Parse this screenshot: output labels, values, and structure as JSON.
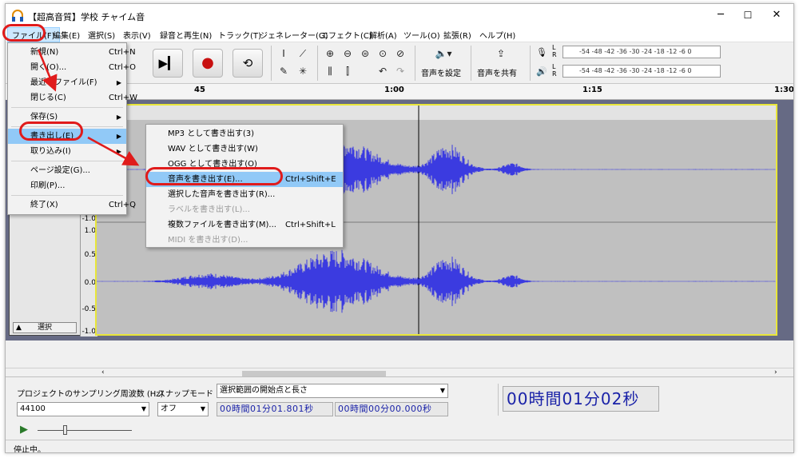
{
  "window": {
    "title": "【超高音質】学校 チャイム音",
    "minimize": "─",
    "maximize": "☐",
    "close": "✕"
  },
  "menubar": [
    {
      "label": "ファイル(F)"
    },
    {
      "label": "編集(E)"
    },
    {
      "label": "選択(S)"
    },
    {
      "label": "表示(V)"
    },
    {
      "label": "録音と再生(N)"
    },
    {
      "label": "トラック(T)"
    },
    {
      "label": "ジェネレーター(G)"
    },
    {
      "label": "エフェクト(C)"
    },
    {
      "label": "解析(A)"
    },
    {
      "label": "ツール(O)"
    },
    {
      "label": "拡張(R)"
    },
    {
      "label": "ヘルプ(H)"
    }
  ],
  "file_menu": [
    {
      "label": "新規(N)",
      "shortcut": "Ctrl+N",
      "submenu": false
    },
    {
      "label": "開く(O)...",
      "shortcut": "Ctrl+O",
      "submenu": false
    },
    {
      "label": "最近のファイル(F)",
      "shortcut": "",
      "submenu": true
    },
    {
      "label": "閉じる(C)",
      "shortcut": "Ctrl+W",
      "submenu": false
    },
    {
      "label": "保存(S)",
      "shortcut": "",
      "submenu": true
    },
    {
      "label": "書き出し(E)",
      "shortcut": "",
      "submenu": true,
      "highlighted": true
    },
    {
      "label": "取り込み(I)",
      "shortcut": "",
      "submenu": true
    },
    {
      "label": "ページ設定(G)...",
      "shortcut": "",
      "submenu": false
    },
    {
      "label": "印刷(P)...",
      "shortcut": "",
      "submenu": false
    },
    {
      "label": "終了(X)",
      "shortcut": "Ctrl+Q",
      "submenu": false
    }
  ],
  "export_submenu": [
    {
      "label": "MP3 として書き出す(3)",
      "shortcut": "",
      "enabled": true
    },
    {
      "label": "WAV として書き出す(W)",
      "shortcut": "",
      "enabled": true
    },
    {
      "label": "OGG として書き出す(O)",
      "shortcut": "",
      "enabled": true
    },
    {
      "label": "音声を書き出す(E)...",
      "shortcut": "Ctrl+Shift+E",
      "enabled": true,
      "highlighted": true
    },
    {
      "label": "選択した音声を書き出す(R)...",
      "shortcut": "",
      "enabled": true
    },
    {
      "label": "ラベルを書き出す(L)...",
      "shortcut": "",
      "enabled": false
    },
    {
      "label": "複数ファイルを書き出す(M)...",
      "shortcut": "Ctrl+Shift+L",
      "enabled": true
    },
    {
      "label": "MIDI を書き出す(D)...",
      "shortcut": "",
      "enabled": false
    }
  ],
  "toolbar": {
    "audio_setup_label": "音声を設定",
    "share_audio_label": "音声を共有",
    "meter_scale": "-54 -48 -42 -36 -30 -24 -18 -12 -6 0",
    "meter_l": "L",
    "meter_r": "R"
  },
  "ruler": {
    "ticks": [
      "45",
      "1:00",
      "1:15",
      "1:30"
    ]
  },
  "track": {
    "scale_labels": [
      "-1.0",
      "1.0",
      "0.5",
      "0.0",
      "-0.5",
      "-1.0"
    ],
    "select_label": "選択",
    "collapse_arrow": "▲"
  },
  "selection_toolbar": {
    "rate_label": "プロジェクトのサンプリング周波数 (Hz)",
    "rate_value": "44100",
    "snap_label": "スナップモード",
    "snap_value": "オフ",
    "selection_mode": "選択範囲の開始点と長さ",
    "start_time": "00時間01分01.801秒",
    "length_time": "00時間00分00.000秒",
    "audio_position": "00時間01分02秒"
  },
  "status": {
    "text": "停止中。"
  },
  "colors": {
    "waveform": "#3b3be0",
    "highlight": "#91c9f7",
    "annotation": "#e01b1b"
  }
}
